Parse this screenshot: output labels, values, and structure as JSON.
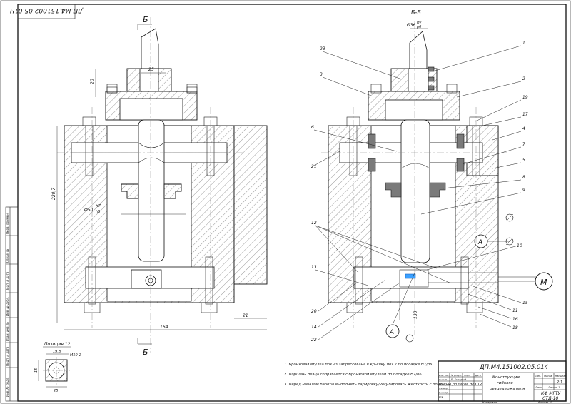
{
  "sheet": {
    "rotated_code": "ДП.М4.151002.05.01Ч",
    "stamp_code": "ДП.М4.151002.05.014",
    "title_line1": "Конструкция",
    "title_line2": "гибкого",
    "title_line3": "резцедержателя",
    "scale": "2:1",
    "org_line1": "КФ МГТУ",
    "org_line2": "СТД-10",
    "copied": "Копировал",
    "format": "Формат  А1",
    "sheet_label": "Лист",
    "sheets_label": "Листов 1",
    "stage_cols": [
      "Лит.",
      "Масса",
      "Масштаб"
    ],
    "developer": "Б. Быстрый",
    "rows": [
      "Изм. Лист",
      "№ докум.",
      "Подп.",
      "Дата",
      "Разраб.",
      "Пров.",
      "Т.контр.",
      "Н.контр.",
      "Утв."
    ]
  },
  "left_strip": [
    "Перв. примен.",
    "Справ. №",
    "Подп. и дата",
    "Инв. № дубл.",
    "Взам. инв. №",
    "Подп. и дата",
    "Инв. № подл."
  ],
  "left_view": {
    "section_mark": "Б",
    "dim_width_top": "25",
    "dim_height_top": "20",
    "dim_height_total": "220,7",
    "dim_fit": "Ø50",
    "dim_fit_upper": "H7",
    "dim_fit_lower": "h6",
    "dim_width_bottom": "164",
    "dim_right": "21"
  },
  "right_view": {
    "section_title": "Б-Б",
    "dim_top": "Ø36",
    "dim_top_fit_upper": "H7",
    "dim_top_fit_lower": "p6",
    "dim_bottom": "130",
    "datum_a": "A",
    "motor": "M",
    "callouts_left": [
      "23",
      "3",
      "6",
      "21",
      "12",
      "13",
      "20",
      "14",
      "22"
    ],
    "callouts_right": [
      "1",
      "2",
      "19",
      "17",
      "4",
      "7",
      "5",
      "8",
      "9",
      "10",
      "15",
      "11",
      "16",
      "18"
    ]
  },
  "position_detail": {
    "title": "Позиция 12",
    "dim_a": "19,8",
    "dim_b": "М10-2",
    "dim_c": "15",
    "dim_d": "25"
  },
  "notes": [
    "1. Бронзовая втулка поз.23 запрессована в крышку поз.2 по посадке H7/p6.",
    "2. Поршень резца сопрягается с бронзовой втулкой по посадке H7/h6.",
    "3. Перед началом работы выполнить тарировку/Регулировать жесткость с помощью роликов поз.12"
  ]
}
